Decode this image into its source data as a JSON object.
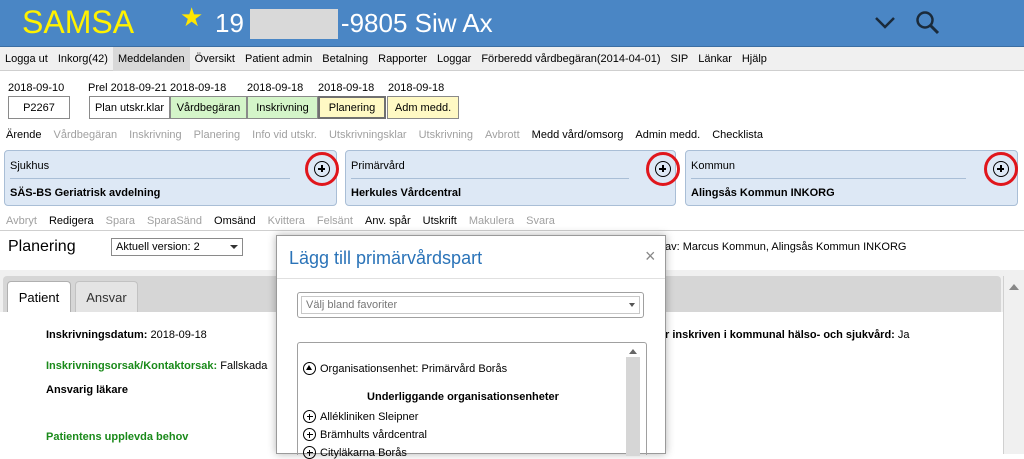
{
  "header": {
    "app_name": "SAMSA",
    "patient_prefix": "19",
    "patient_suffix": "-9805 Siw Ax",
    "brand_color": "#4a86c5",
    "title_color": "#fff200"
  },
  "menu": [
    {
      "label": "Logga ut"
    },
    {
      "label": "Inkorg(42)"
    },
    {
      "label": "Meddelanden",
      "active": true
    },
    {
      "label": "Översikt"
    },
    {
      "label": "Patient admin"
    },
    {
      "label": "Betalning"
    },
    {
      "label": "Rapporter"
    },
    {
      "label": "Loggar"
    },
    {
      "label": "Förberedd vårdbegäran(2014-04-01)"
    },
    {
      "label": "SIP"
    },
    {
      "label": "Länkar"
    },
    {
      "label": "Hjälp"
    }
  ],
  "process": {
    "dates": [
      "2018-09-10",
      "Prel 2018-09-21",
      "2018-09-18",
      "2018-09-18",
      "2018-09-18",
      "2018-09-18"
    ],
    "steps": [
      "P2267",
      "Plan utskr.klar",
      "Vårdbegäran",
      "Inskrivning",
      "Planering",
      "Adm medd."
    ]
  },
  "actions": {
    "items": [
      "Ärende",
      "Vårdbegäran",
      "Inskrivning",
      "Planering",
      "Info vid utskr.",
      "Utskrivningsklar",
      "Utskrivning",
      "Avbrott",
      "Medd vård/omsorg",
      "Admin medd.",
      "Checklista"
    ]
  },
  "parties": [
    {
      "title": "Sjukhus",
      "value": "SÄS-BS Geriatrisk avdelning"
    },
    {
      "title": "Primärvård",
      "value": "Herkules Vårdcentral"
    },
    {
      "title": "Kommun",
      "value": "Alingsås Kommun INKORG"
    }
  ],
  "edit": {
    "items": [
      "Avbryt",
      "Redigera",
      "Spara",
      "SparaSänd",
      "Omsänd",
      "Kvittera",
      "Felsänt",
      "Anv. spår",
      "Utskrift",
      "Makulera",
      "Svara"
    ]
  },
  "planering": {
    "title": "Planering",
    "version": "Aktuell version: 2",
    "author": "av: Marcus Kommun, Alingsås Kommun INKORG"
  },
  "tabs": [
    "Patient",
    "Ansvar"
  ],
  "patient_fields": {
    "inskrivningsdatum_label": "Inskrivningsdatum:",
    "inskrivningsdatum_value": "2018-09-18",
    "orsak_label": "Inskrivningsorsak/Kontaktorsak:",
    "orsak_value": "Fallskada",
    "ansvarig_label": "Ansvarig läkare",
    "behov_label": "Patientens upplevda behov",
    "kommunal_label": "r inskriven i kommunal hälso- och sjukvård:",
    "kommunal_value": "Ja"
  },
  "dialog": {
    "title": "Lägg till primärvårdspart",
    "close": "×",
    "favorites_placeholder": "Välj bland favoriter",
    "org_parent": "Organisationsenhet: Primärvård Borås",
    "sub_heading": "Underliggande organisationsenheter",
    "units": [
      "Allékliniken Sleipner",
      "Brämhults vårdcentral",
      "Cityläkarna Borås"
    ]
  }
}
